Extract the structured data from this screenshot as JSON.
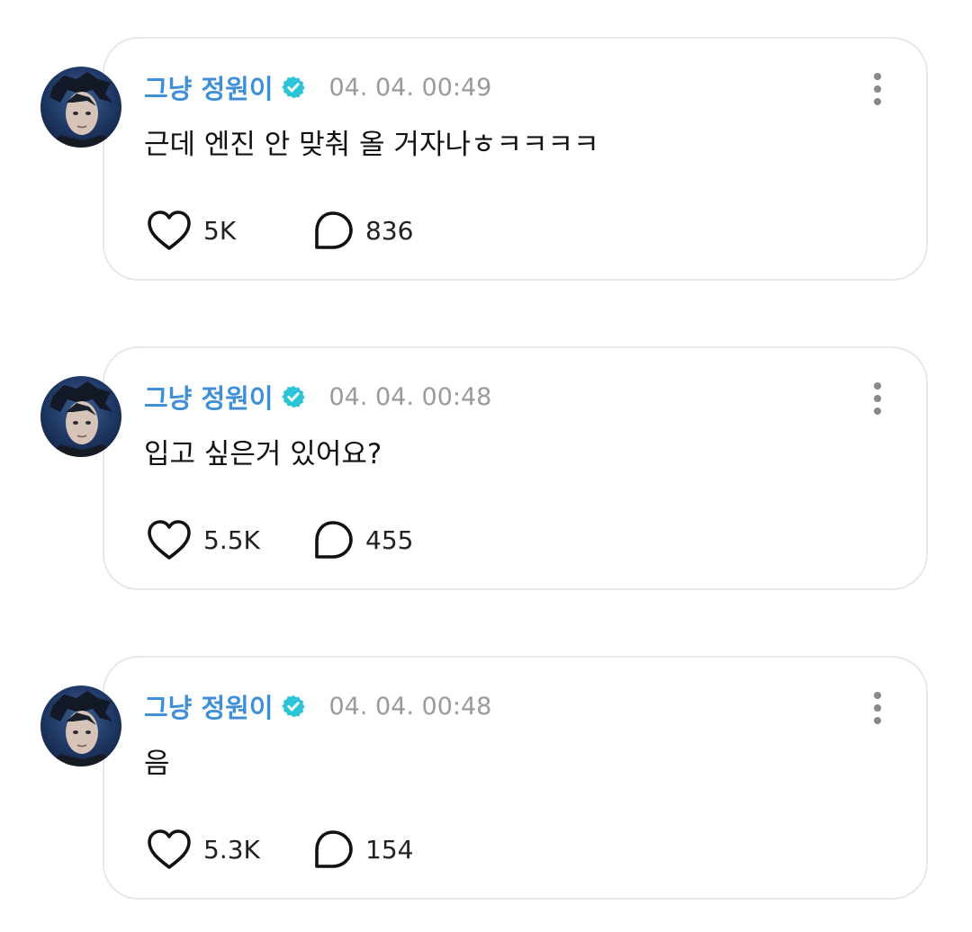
{
  "colors": {
    "author": "#3f8fd8",
    "verified_badge": "#2ec4d8",
    "timestamp": "#9a9a9a",
    "card_border": "#e5e7eb"
  },
  "icons": {
    "like": "heart-outline-icon",
    "comment": "speech-bubble-icon",
    "more": "vertical-dots-icon",
    "verified": "verified-badge-icon"
  },
  "posts": [
    {
      "author": "그냥 정원이",
      "timestamp": "04. 04. 00:49",
      "content": "근데 엔진 안 맞춰 올 거자나ㅎㅋㅋㅋㅋ",
      "likes": "5K",
      "comments": "836"
    },
    {
      "author": "그냥 정원이",
      "timestamp": "04. 04. 00:48",
      "content": "입고 싶은거 있어요?",
      "likes": "5.5K",
      "comments": "455"
    },
    {
      "author": "그냥 정원이",
      "timestamp": "04. 04. 00:48",
      "content": "음",
      "likes": "5.3K",
      "comments": "154"
    }
  ]
}
